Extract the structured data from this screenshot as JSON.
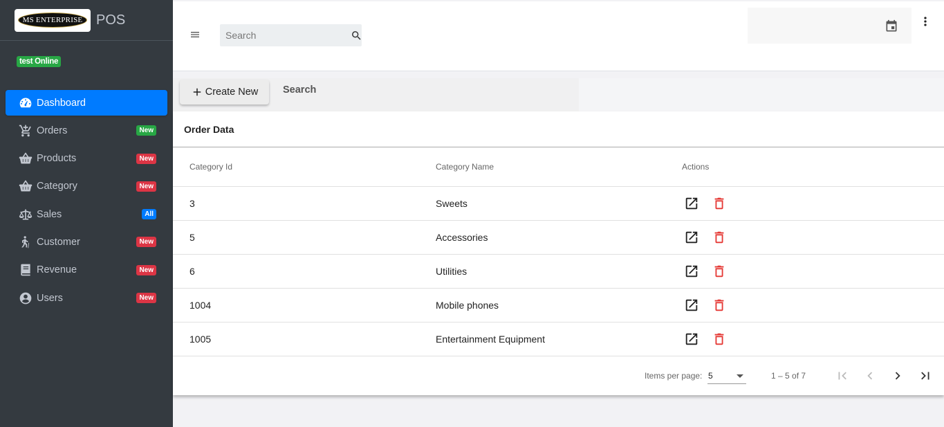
{
  "brand": {
    "logo_text": "MS ENTERPRISE",
    "app_name": "POS"
  },
  "user": {
    "status": "test Online"
  },
  "sidebar": {
    "items": [
      {
        "label": "Dashboard",
        "icon": "dashboard-icon",
        "badge": "",
        "active": true
      },
      {
        "label": "Orders",
        "icon": "cart-icon",
        "badge": "New",
        "badge_color": "green"
      },
      {
        "label": "Products",
        "icon": "basket-icon",
        "badge": "New",
        "badge_color": "red"
      },
      {
        "label": "Category",
        "icon": "basket-icon",
        "badge": "New",
        "badge_color": "red"
      },
      {
        "label": "Sales",
        "icon": "balance-scale-icon",
        "badge": "All",
        "badge_color": "blue"
      },
      {
        "label": "Customer",
        "icon": "walking-icon",
        "badge": "New",
        "badge_color": "red"
      },
      {
        "label": "Revenue",
        "icon": "book-icon",
        "badge": "New",
        "badge_color": "red"
      },
      {
        "label": "Users",
        "icon": "user-circle-icon",
        "badge": "New",
        "badge_color": "red"
      }
    ]
  },
  "header": {
    "search_placeholder": "Search"
  },
  "toolbar": {
    "create_label": "Create New",
    "search_label": "Search"
  },
  "card": {
    "title": "Order Data"
  },
  "table": {
    "columns": [
      "Category Id",
      "Category Name",
      "Actions"
    ],
    "rows": [
      {
        "id": "3",
        "name": "Sweets"
      },
      {
        "id": "5",
        "name": "Accessories"
      },
      {
        "id": "6",
        "name": "Utilities"
      },
      {
        "id": "1004",
        "name": "Mobile phones"
      },
      {
        "id": "1005",
        "name": "Entertainment Equipment"
      }
    ]
  },
  "paginator": {
    "items_per_page_label": "Items per page:",
    "page_size": "5",
    "range": "1 – 5 of 7"
  },
  "colors": {
    "sidebar_bg": "#343a40",
    "accent": "#007bff",
    "success": "#28a745",
    "danger": "#dc3545",
    "delete_icon": "#e53935"
  }
}
